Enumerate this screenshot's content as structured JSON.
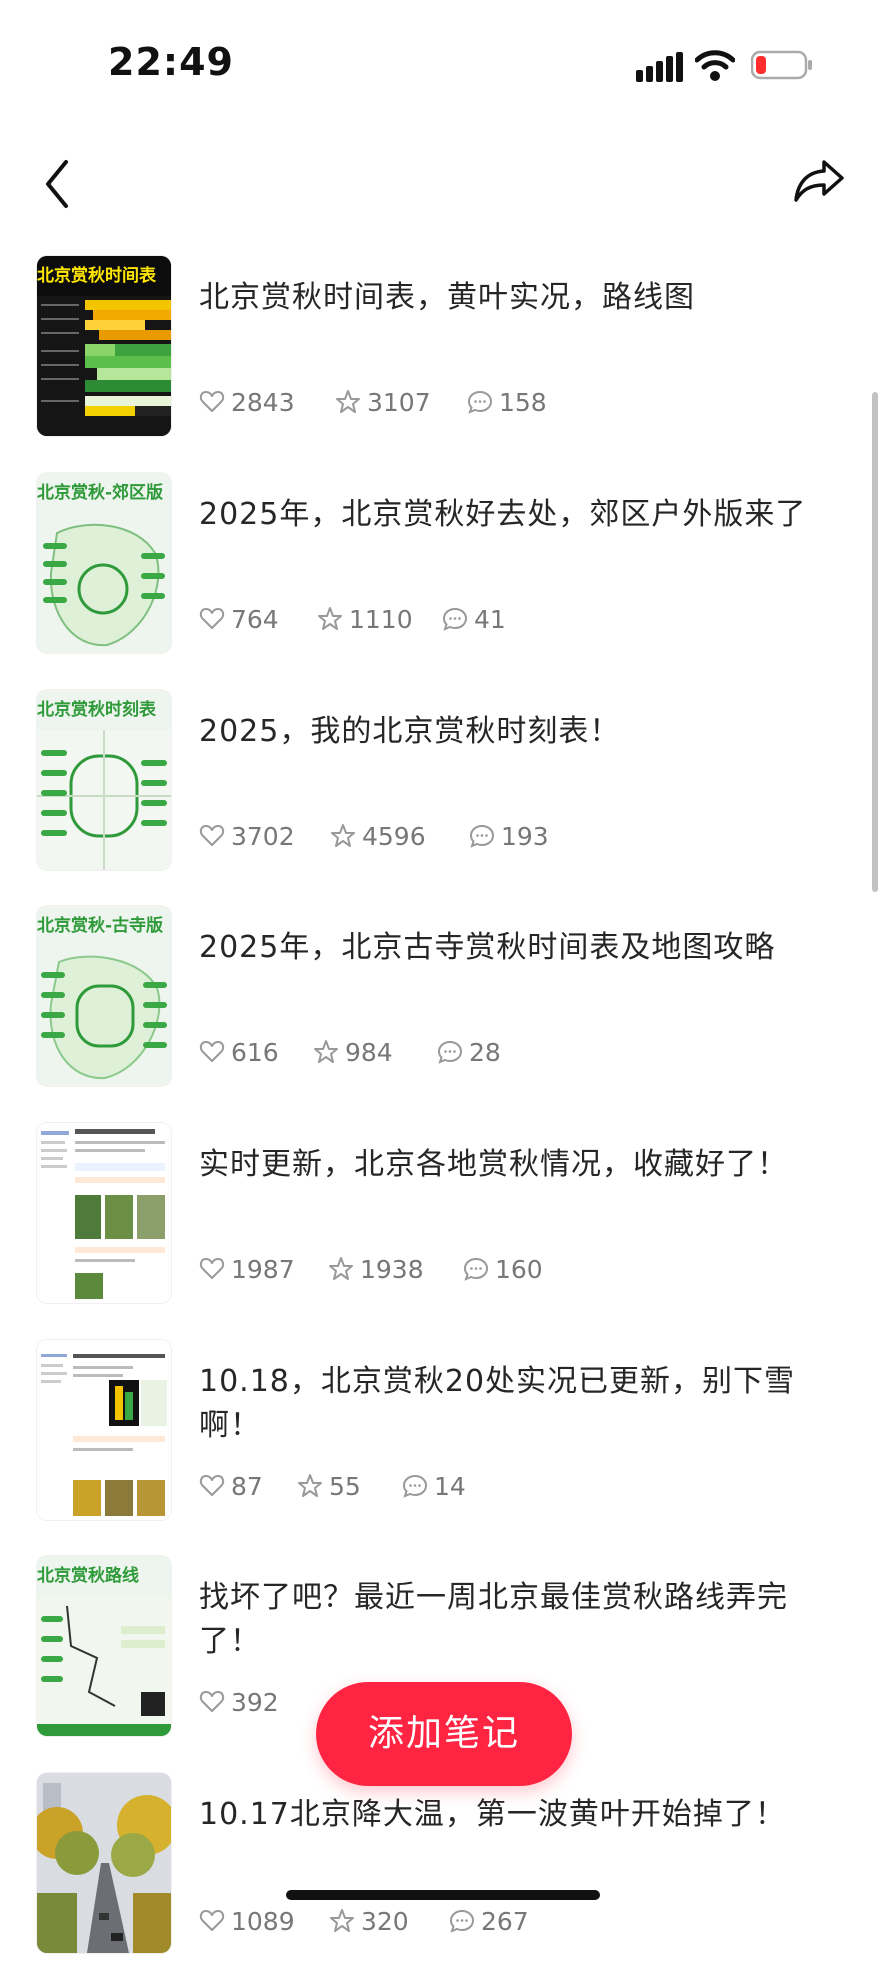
{
  "status_bar": {
    "time": "22:49"
  },
  "nav": {
    "back_icon": "chevron-left-icon",
    "share_icon": "share-arrow-icon"
  },
  "notes": [
    {
      "title": "北京赏秋时间表，黄叶实况，路线图",
      "likes": "2843",
      "collects": "3107",
      "comments": "158",
      "thumb_text": "北京赏秋时间表"
    },
    {
      "title": "2025年，北京赏秋好去处，郊区户外版来了",
      "likes": "764",
      "collects": "1110",
      "comments": "41",
      "thumb_text": "北京赏秋-郊区版"
    },
    {
      "title": "2025，我的北京赏秋时刻表！",
      "likes": "3702",
      "collects": "4596",
      "comments": "193",
      "thumb_text": "北京赏秋时刻表"
    },
    {
      "title": "2025年，北京古寺赏秋时间表及地图攻略",
      "likes": "616",
      "collects": "984",
      "comments": "28",
      "thumb_text": "北京赏秋-古寺版"
    },
    {
      "title": "实时更新，北京各地赏秋情况，收藏好了！",
      "likes": "1987",
      "collects": "1938",
      "comments": "160",
      "thumb_text": ""
    },
    {
      "title": "10.18，北京赏秋20处实况已更新，别下雪啊！",
      "likes": "87",
      "collects": "55",
      "comments": "14",
      "thumb_text": ""
    },
    {
      "title": "找坏了吧？最近一周北京最佳赏秋路线弄完了！",
      "likes": "392",
      "collects": "",
      "comments": "",
      "thumb_text": "北京赏秋路线"
    },
    {
      "title": "10.17北京降大温，第一波黄叶开始掉了！",
      "likes": "1089",
      "collects": "320",
      "comments": "267",
      "thumb_text": ""
    }
  ],
  "fab": {
    "label": "添加笔记"
  },
  "colors": {
    "accent": "#ff2442",
    "title_green": "#2f9a3a",
    "title_yellow": "#ffe600"
  }
}
